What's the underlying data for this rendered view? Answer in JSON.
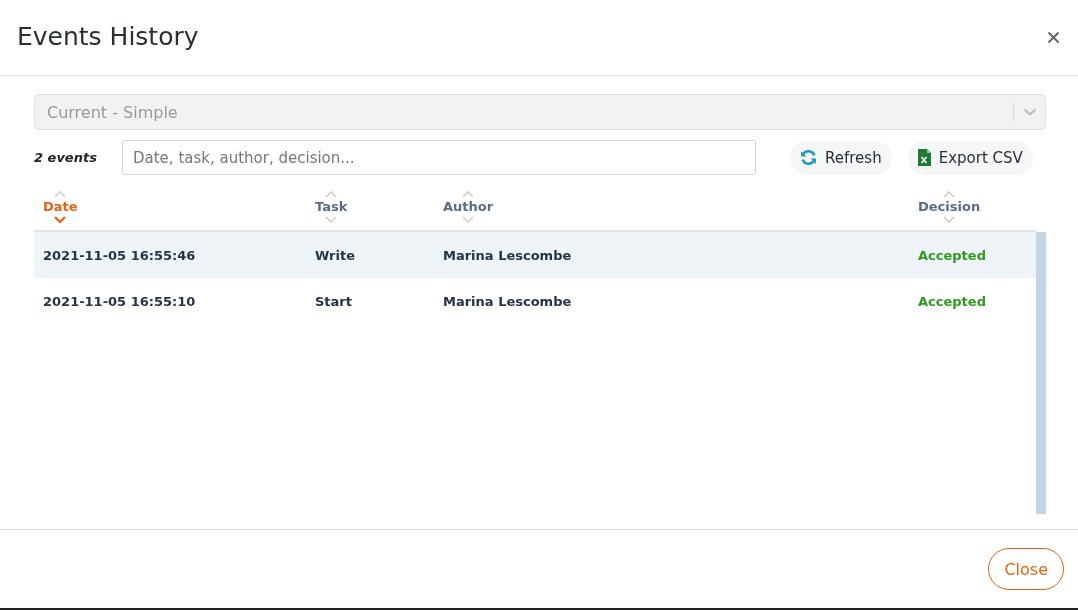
{
  "dialog": {
    "title": "Events History"
  },
  "view_select": {
    "value": "Current - Simple",
    "disabled": true
  },
  "event_count": "2 events",
  "search": {
    "placeholder": "Date, task, author, decision..."
  },
  "toolbar_buttons": [
    {
      "kind": "refresh",
      "label": "Refresh"
    },
    {
      "kind": "export",
      "label": "Export CSV"
    }
  ],
  "table": {
    "columns": [
      {
        "label": "Date",
        "sorted": true
      },
      {
        "label": "Task",
        "sorted": false
      },
      {
        "label": "Author",
        "sorted": false
      },
      {
        "label": "Decision",
        "sorted": false
      }
    ],
    "rows": [
      {
        "selected": true,
        "cells": [
          "2021-11-05 16:55:46",
          "Write",
          "Marina Lescombe",
          "Accepted"
        ]
      },
      {
        "selected": false,
        "cells": [
          "2021-11-05 16:55:10",
          "Start",
          "Marina Lescombe",
          "Accepted"
        ]
      }
    ]
  },
  "footer_button": "Close"
}
